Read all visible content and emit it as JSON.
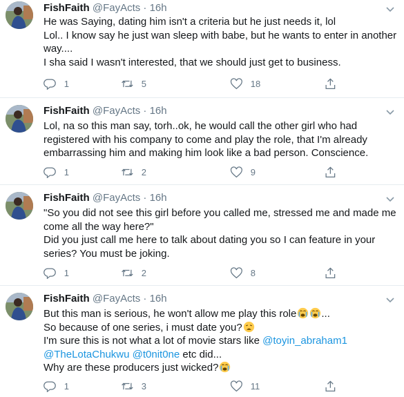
{
  "tweets": [
    {
      "name": "FishFaith",
      "handle": "@FayActs",
      "dot": "·",
      "time": "16h",
      "lines": [
        "He was Saying, dating him isn't a criteria but he just needs it, lol",
        "Lol.. I know say he just wan sleep with babe, but he wants to enter in another",
        "way....",
        "I sha said I wasn't interested, that we should just get to business."
      ],
      "replies": "1",
      "retweets": "5",
      "likes": "18"
    },
    {
      "name": "FishFaith",
      "handle": "@FayActs",
      "dot": "·",
      "time": "16h",
      "lines": [
        "Lol, na so this man say, torh..ok, he would call the other girl who had",
        "registered with his company to come and play the role, that I'm already",
        "embarrassing him and making him look like a bad person. Conscience."
      ],
      "replies": "1",
      "retweets": "2",
      "likes": "9"
    },
    {
      "name": "FishFaith",
      "handle": "@FayActs",
      "dot": "·",
      "time": "16h",
      "lines": [
        "\"So you did not see this girl before you called me, stressed me and made me",
        "come all the way here?\"",
        "Did you just call me here to talk about dating you so I can feature in your",
        "series? You must be joking."
      ],
      "replies": "1",
      "retweets": "2",
      "likes": "8"
    },
    {
      "name": "FishFaith",
      "handle": "@FayActs",
      "dot": "·",
      "time": "16h",
      "line1": "But this man is serious, he won't allow me play this role",
      "line1_end": "...",
      "line2": "So because of one series, i must date you?",
      "line3": "I'm sure this is not what a lot of movie stars like ",
      "mention1": "@toyin_abraham1",
      "mention2": "@TheLotaChukwu",
      "mention3": "@t0nit0ne",
      "line4_end": " etc did...",
      "line5": "Why are these producers just wicked?",
      "replies": "1",
      "retweets": "3",
      "likes": "11"
    }
  ],
  "icons": {
    "reply": "reply-icon",
    "retweet": "retweet-icon",
    "like": "heart-icon",
    "share": "share-icon",
    "more": "chevron-down-icon",
    "emoji_crying": "loudly-crying-face-emoji",
    "emoji_weary": "weary-face-emoji"
  },
  "colors": {
    "text": "#14171a",
    "secondary": "#657786",
    "link": "#1b95e0",
    "divider": "#e6ecf0"
  }
}
